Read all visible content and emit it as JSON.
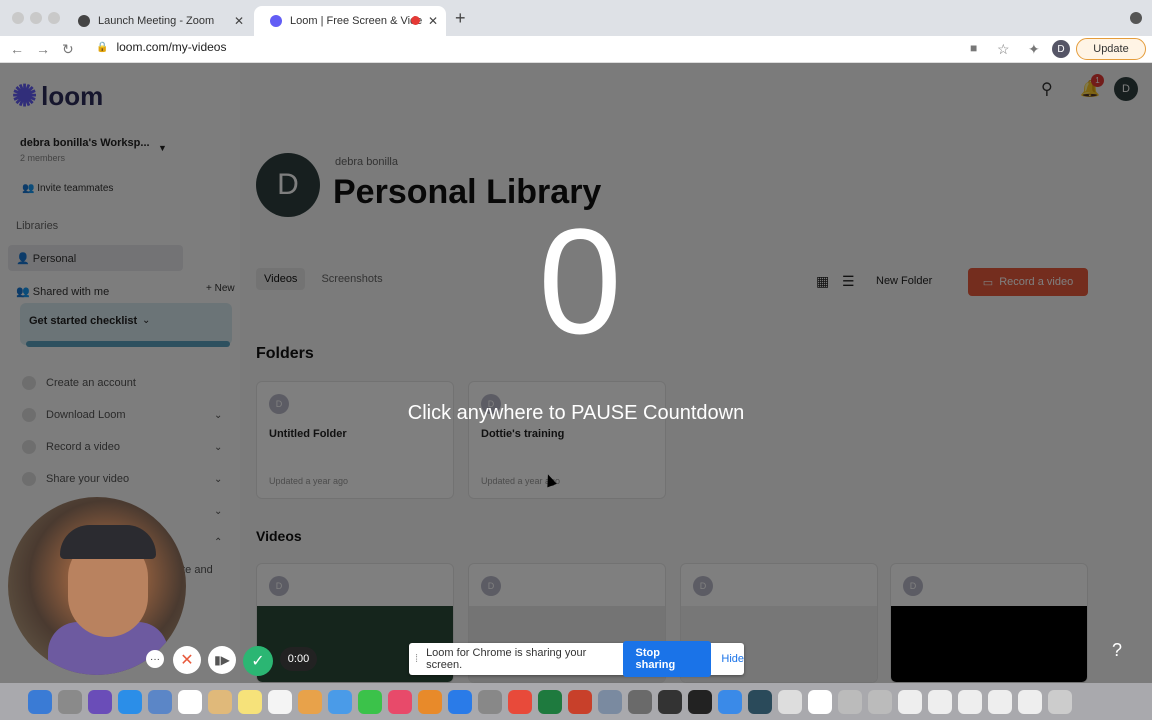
{
  "browser": {
    "tabs": [
      {
        "title": "Launch Meeting - Zoom"
      },
      {
        "title": "Loom | Free Screen & Vide"
      }
    ],
    "url": "loom.com/my-videos",
    "update_label": "Update",
    "profile_initial": "D"
  },
  "sidebar": {
    "workspace_name": "debra bonilla's Worksp...",
    "members": "2 members",
    "invite": "Invite teammates",
    "libraries_heading": "Libraries",
    "personal": "Personal",
    "shared": "Shared with me",
    "new_label": "New",
    "checklist_title": "Get started checklist",
    "checklist_items": [
      "Create an account",
      "Download Loom",
      "Record a video",
      "Share your video"
    ],
    "truncated_text": "ate and"
  },
  "header": {
    "notification_count": "1",
    "user_initial": "D"
  },
  "library": {
    "avatar_initial": "D",
    "owner": "debra bonilla",
    "title": "Personal Library",
    "tabs": [
      "Videos",
      "Screenshots"
    ],
    "new_folder": "New Folder",
    "record_video": "Record a video",
    "folders_heading": "Folders",
    "folders": [
      {
        "initial": "D",
        "name": "Untitled Folder",
        "updated": "Updated a year ago"
      },
      {
        "initial": "D",
        "name": "Dottie's training",
        "updated": "Updated a year ago"
      }
    ],
    "videos_heading": "Videos",
    "video_initials": [
      "D",
      "D",
      "D",
      "D"
    ]
  },
  "countdown": {
    "number": "0",
    "message": "Click anywhere to PAUSE Countdown"
  },
  "recorder": {
    "timer": "0:00"
  },
  "share_bar": {
    "message": "Loom for Chrome is sharing your screen.",
    "stop_label": "Stop sharing",
    "hide_label": "Hide"
  },
  "help_label": "?",
  "colors": {
    "accent": "#e85a3c",
    "loom_purple": "#625df5",
    "share_blue": "#1a73e8"
  }
}
